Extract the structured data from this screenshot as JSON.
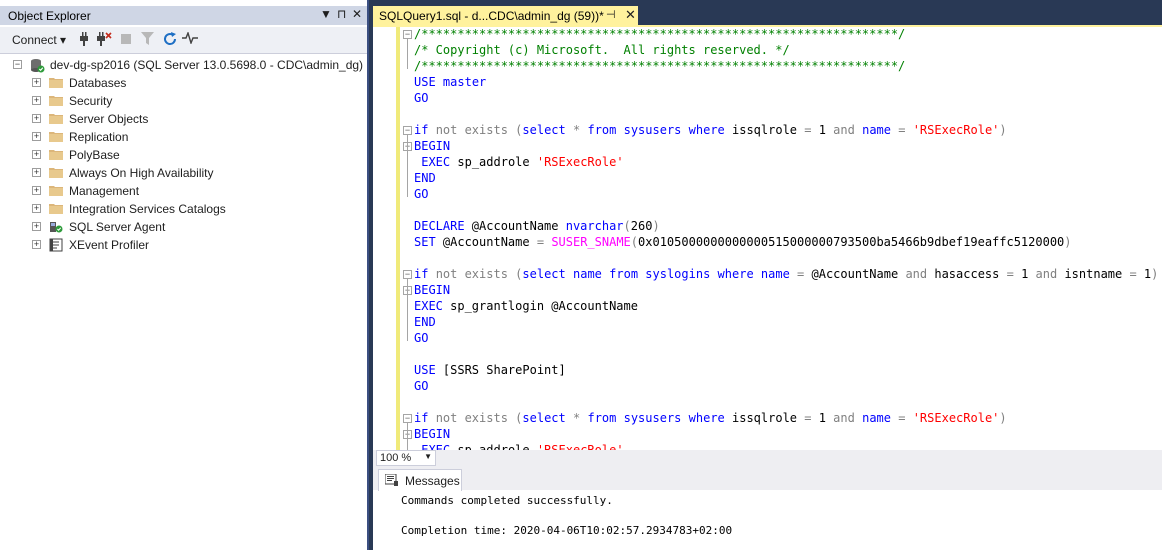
{
  "object_explorer": {
    "title": "Object Explorer",
    "controls": {
      "dropdown": "▼",
      "pin": "⊓",
      "close": "✕"
    },
    "toolbar": {
      "connect_label": "Connect ▾",
      "buttons": [
        "connect-plug-icon",
        "disconnect-icon",
        "stop-icon",
        "filter-icon",
        "refresh-icon",
        "activity-monitor-icon"
      ]
    },
    "server": {
      "label": "dev-dg-sp2016 (SQL Server 13.0.5698.0 - CDC\\admin_dg)",
      "expander": "−",
      "children": [
        {
          "label": "Databases",
          "icon": "folder-icon"
        },
        {
          "label": "Security",
          "icon": "folder-icon"
        },
        {
          "label": "Server Objects",
          "icon": "folder-icon"
        },
        {
          "label": "Replication",
          "icon": "folder-icon"
        },
        {
          "label": "PolyBase",
          "icon": "folder-icon"
        },
        {
          "label": "Always On High Availability",
          "icon": "folder-icon"
        },
        {
          "label": "Management",
          "icon": "folder-icon"
        },
        {
          "label": "Integration Services Catalogs",
          "icon": "folder-icon"
        },
        {
          "label": "SQL Server Agent",
          "icon": "agent-icon"
        },
        {
          "label": "XEvent Profiler",
          "icon": "profiler-icon"
        }
      ]
    }
  },
  "editor_tab": {
    "label": "SQLQuery1.sql - d...CDC\\admin_dg (59))*",
    "pin": "⊣",
    "close": "✕"
  },
  "code_lines": [
    [
      [
        "cm",
        "/******************************************************************/"
      ]
    ],
    [
      [
        "cm",
        "/* Copyright (c) Microsoft.  All rights reserved. */"
      ]
    ],
    [
      [
        "cm",
        "/******************************************************************/"
      ]
    ],
    [
      [
        "kw",
        "USE"
      ],
      [
        "tx",
        " "
      ],
      [
        "kw",
        "master"
      ]
    ],
    [
      [
        "kw",
        "GO"
      ]
    ],
    [],
    [
      [
        "kw",
        "if"
      ],
      [
        "tx",
        " "
      ],
      [
        "gr",
        "not exists"
      ],
      [
        "tx",
        " "
      ],
      [
        "gr",
        "("
      ],
      [
        "kw",
        "select"
      ],
      [
        "tx",
        " "
      ],
      [
        "gr",
        "*"
      ],
      [
        "tx",
        " "
      ],
      [
        "kw",
        "from"
      ],
      [
        "tx",
        " "
      ],
      [
        "kw",
        "sysusers"
      ],
      [
        "tx",
        " "
      ],
      [
        "kw",
        "where"
      ],
      [
        "tx",
        " issqlrole "
      ],
      [
        "gr",
        "="
      ],
      [
        "tx",
        " 1 "
      ],
      [
        "gr",
        "and"
      ],
      [
        "tx",
        " "
      ],
      [
        "kw",
        "name"
      ],
      [
        "tx",
        " "
      ],
      [
        "gr",
        "="
      ],
      [
        "tx",
        " "
      ],
      [
        "str",
        "'RSExecRole'"
      ],
      [
        "gr",
        ")"
      ]
    ],
    [
      [
        "kw",
        "BEGIN"
      ]
    ],
    [
      [
        "tx",
        " "
      ],
      [
        "kw",
        "EXEC"
      ],
      [
        "tx",
        " sp_addrole "
      ],
      [
        "str",
        "'RSExecRole'"
      ]
    ],
    [
      [
        "kw",
        "END"
      ]
    ],
    [
      [
        "kw",
        "GO"
      ]
    ],
    [],
    [
      [
        "kw",
        "DECLARE"
      ],
      [
        "tx",
        " @AccountName "
      ],
      [
        "kw",
        "nvarchar"
      ],
      [
        "gr",
        "("
      ],
      [
        "tx",
        "260"
      ],
      [
        "gr",
        ")"
      ]
    ],
    [
      [
        "kw",
        "SET"
      ],
      [
        "tx",
        " @AccountName "
      ],
      [
        "gr",
        "="
      ],
      [
        "tx",
        " "
      ],
      [
        "fn",
        "SUSER_SNAME"
      ],
      [
        "gr",
        "("
      ],
      [
        "tx",
        "0x0105000000000000515000000793500ba5466b9dbef19eaffc5120000"
      ],
      [
        "gr",
        ")"
      ]
    ],
    [],
    [
      [
        "kw",
        "if"
      ],
      [
        "tx",
        " "
      ],
      [
        "gr",
        "not exists"
      ],
      [
        "tx",
        " "
      ],
      [
        "gr",
        "("
      ],
      [
        "kw",
        "select"
      ],
      [
        "tx",
        " "
      ],
      [
        "kw",
        "name"
      ],
      [
        "tx",
        " "
      ],
      [
        "kw",
        "from"
      ],
      [
        "tx",
        " "
      ],
      [
        "kw",
        "syslogins"
      ],
      [
        "tx",
        " "
      ],
      [
        "kw",
        "where"
      ],
      [
        "tx",
        " "
      ],
      [
        "kw",
        "name"
      ],
      [
        "tx",
        " "
      ],
      [
        "gr",
        "="
      ],
      [
        "tx",
        " @AccountName "
      ],
      [
        "gr",
        "and"
      ],
      [
        "tx",
        " hasaccess "
      ],
      [
        "gr",
        "="
      ],
      [
        "tx",
        " 1 "
      ],
      [
        "gr",
        "and"
      ],
      [
        "tx",
        " isntname "
      ],
      [
        "gr",
        "="
      ],
      [
        "tx",
        " 1"
      ],
      [
        "gr",
        ")"
      ]
    ],
    [
      [
        "kw",
        "BEGIN"
      ]
    ],
    [
      [
        "kw",
        "EXEC"
      ],
      [
        "tx",
        " sp_grantlogin @AccountName"
      ]
    ],
    [
      [
        "kw",
        "END"
      ]
    ],
    [
      [
        "kw",
        "GO"
      ]
    ],
    [],
    [
      [
        "kw",
        "USE"
      ],
      [
        "tx",
        " [SSRS SharePoint]"
      ]
    ],
    [
      [
        "kw",
        "GO"
      ]
    ],
    [],
    [
      [
        "kw",
        "if"
      ],
      [
        "tx",
        " "
      ],
      [
        "gr",
        "not exists"
      ],
      [
        "tx",
        " "
      ],
      [
        "gr",
        "("
      ],
      [
        "kw",
        "select"
      ],
      [
        "tx",
        " "
      ],
      [
        "gr",
        "*"
      ],
      [
        "tx",
        " "
      ],
      [
        "kw",
        "from"
      ],
      [
        "tx",
        " "
      ],
      [
        "kw",
        "sysusers"
      ],
      [
        "tx",
        " "
      ],
      [
        "kw",
        "where"
      ],
      [
        "tx",
        " issqlrole "
      ],
      [
        "gr",
        "="
      ],
      [
        "tx",
        " 1 "
      ],
      [
        "gr",
        "and"
      ],
      [
        "tx",
        " "
      ],
      [
        "kw",
        "name"
      ],
      [
        "tx",
        " "
      ],
      [
        "gr",
        "="
      ],
      [
        "tx",
        " "
      ],
      [
        "str",
        "'RSExecRole'"
      ],
      [
        "gr",
        ")"
      ]
    ],
    [
      [
        "kw",
        "BEGIN"
      ]
    ],
    [
      [
        "tx",
        " "
      ],
      [
        "kw",
        "EXEC"
      ],
      [
        "tx",
        " sp_addrole "
      ],
      [
        "str",
        "'RSExecRole'"
      ]
    ]
  ],
  "zoom": {
    "value": "100 %",
    "arrow": "▼"
  },
  "results": {
    "tab_label": "Messages",
    "messages": [
      "Commands completed successfully.",
      "",
      "Completion time: 2020-04-06T10:02:57.2934783+02:00"
    ]
  },
  "colors": {
    "chrome": "#293955",
    "active_tab": "#fff29d",
    "keyword": "#0000ff",
    "operator": "#808080",
    "string": "#ff0000",
    "comment": "#008000",
    "system_function": "#ff00ff"
  }
}
